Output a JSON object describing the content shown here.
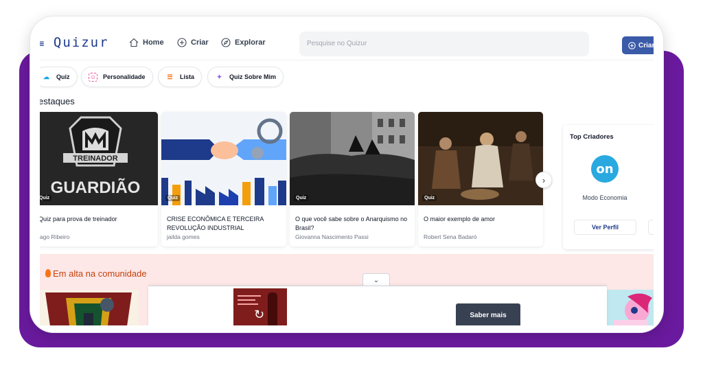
{
  "header": {
    "logo": "Quizur",
    "nav": [
      {
        "label": "Home",
        "icon": "home-icon"
      },
      {
        "label": "Criar",
        "icon": "plus-circle-icon"
      },
      {
        "label": "Explorar",
        "icon": "compass-icon"
      }
    ],
    "search_placeholder": "Pesquise no Quizur",
    "criar_button": "Criar"
  },
  "chips": [
    {
      "label": "Quiz",
      "icon": "quiz-icon",
      "color": "#0ea5e9"
    },
    {
      "label": "Personalidade",
      "icon": "personality-icon",
      "color": "#ec4899"
    },
    {
      "label": "Lista",
      "icon": "list-icon",
      "color": "#f97316"
    },
    {
      "label": "Quiz Sobre Mim",
      "icon": "sparkle-icon",
      "color": "#8b5cf6"
    }
  ],
  "destaques": {
    "title": "estaques",
    "cards": [
      {
        "tag": "Quiz",
        "title": "Quiz para prova de treinador",
        "author": "iago Ribeiro"
      },
      {
        "tag": "Quiz",
        "title": "CRISE ECONÔMICA E TERCEIRA REVOLUÇÃO INDUSTRIAL",
        "author": "jailda gomes"
      },
      {
        "tag": "Quiz",
        "title": "O que você sabe sobre o Anarquismo no Brasil?",
        "author": "Giovanna Nascimento Passi"
      },
      {
        "tag": "Quiz",
        "title": "O maior exemplo de amor",
        "author": "Robert Sena Badaró"
      }
    ]
  },
  "card1_image": {
    "line1": "TREINADOR",
    "line2": "GUARDIÃO"
  },
  "top_criadores": {
    "title": "Top Criadores",
    "creator_name": "Modo Economia",
    "avatar_text": "on",
    "button": "Ver Perfil"
  },
  "trending": {
    "title": "Em alta na comunidade"
  },
  "ad": {
    "button": "Saber mais"
  }
}
